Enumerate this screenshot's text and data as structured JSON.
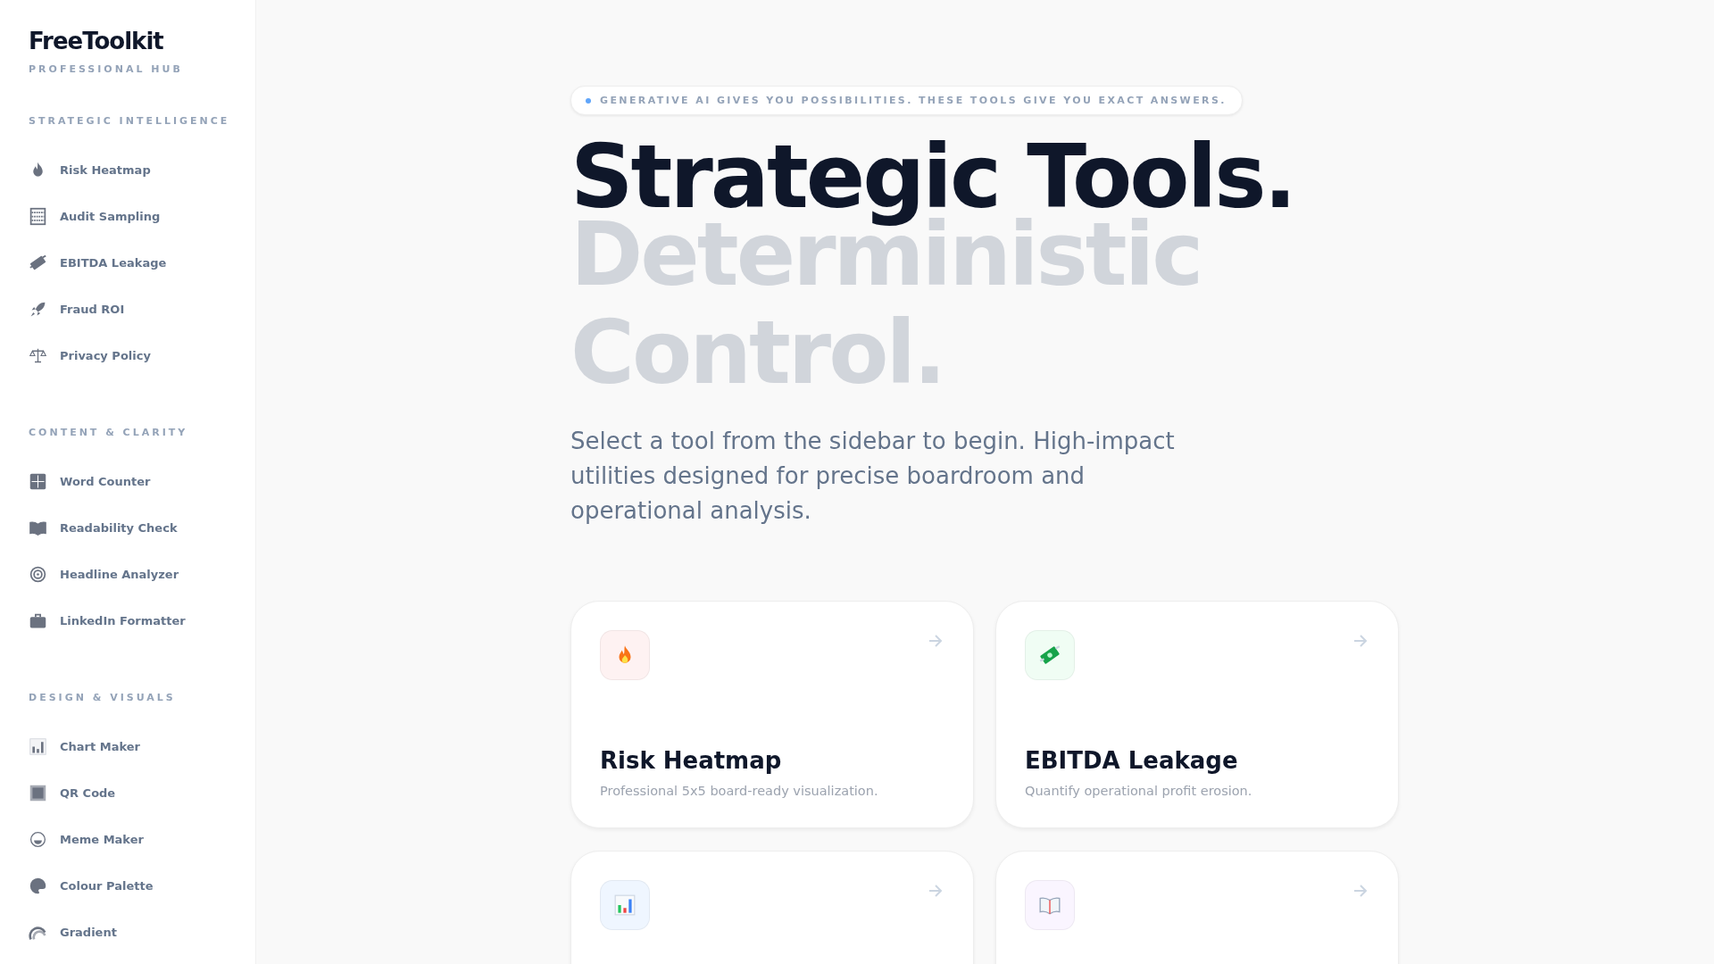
{
  "sidebar": {
    "logo": "FreeToolkit",
    "tagline": "PROFESSIONAL HUB",
    "sections": [
      {
        "title": "STRATEGIC INTELLIGENCE",
        "items": [
          {
            "label": "Risk Heatmap",
            "kind": "flame"
          },
          {
            "label": "Audit Sampling",
            "kind": "abacus"
          },
          {
            "label": "EBITDA Leakage",
            "kind": "money"
          },
          {
            "label": "Fraud ROI",
            "kind": "rocket"
          },
          {
            "label": "Privacy Policy",
            "kind": "scales"
          }
        ]
      },
      {
        "title": "CONTENT & CLARITY",
        "items": [
          {
            "label": "Word Counter",
            "kind": "numbers"
          },
          {
            "label": "Readability Check",
            "kind": "book"
          },
          {
            "label": "Headline Analyzer",
            "kind": "target"
          },
          {
            "label": "LinkedIn Formatter",
            "kind": "briefcase"
          }
        ]
      },
      {
        "title": "DESIGN & VISUALS",
        "items": [
          {
            "label": "Chart Maker",
            "kind": "chart"
          },
          {
            "label": "QR Code",
            "kind": "square"
          },
          {
            "label": "Meme Maker",
            "kind": "grin"
          },
          {
            "label": "Colour Palette",
            "kind": "palette"
          },
          {
            "label": "Gradient",
            "kind": "rainbow"
          }
        ]
      }
    ]
  },
  "hero": {
    "badge": "GENERATIVE AI GIVES YOU POSSIBILITIES. THESE TOOLS GIVE YOU EXACT ANSWERS.",
    "headline": "Strategic Tools.",
    "headline_muted": "Deterministic Control.",
    "intro": "Select a tool from the sidebar to begin. High-impact utilities designed for precise boardroom and operational analysis."
  },
  "cards": [
    {
      "kind": "flame",
      "color": "#fef2f2",
      "title": "Risk Heatmap",
      "description": "Professional 5x5 board-ready visualization."
    },
    {
      "kind": "money",
      "color": "#f0fdf4",
      "title": "EBITDA Leakage",
      "description": "Quantify operational profit erosion."
    },
    {
      "kind": "chart",
      "color": "#eff6ff"
    },
    {
      "kind": "book",
      "color": "#faf5ff"
    }
  ]
}
